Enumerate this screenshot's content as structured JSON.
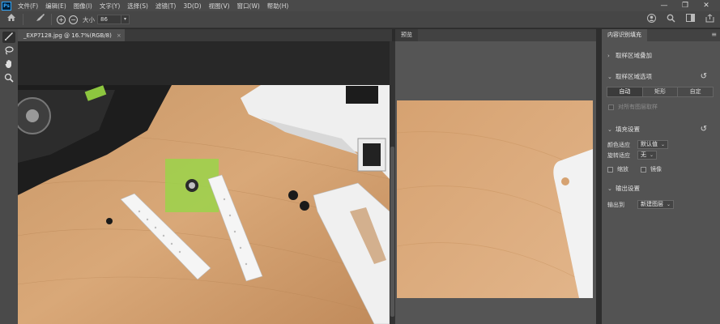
{
  "app": {
    "logo": "Ps"
  },
  "menu": [
    "文件(F)",
    "编辑(E)",
    "图像(I)",
    "文字(Y)",
    "选择(S)",
    "滤镜(T)",
    "3D(D)",
    "视图(V)",
    "窗口(W)",
    "帮助(H)"
  ],
  "window_controls": {
    "minimize": "—",
    "maximize": "❐",
    "close": "✕"
  },
  "options": {
    "size_label": "大小",
    "size_value": "86",
    "plus": "+",
    "minus": "−"
  },
  "document": {
    "tab_title": "_EXP7128.jpg @ 16.7%(RGB/8)",
    "close": "×"
  },
  "preview": {
    "tab_label": "预览"
  },
  "panel": {
    "tab_label": "内容识别填充",
    "sampling_overlay": "取样区域叠加",
    "sampling_options": "取样区域选项",
    "mode_buttons": [
      "自动",
      "矩形",
      "自定"
    ],
    "sample_all_layers": "对所有图层取样",
    "fill_settings": "填充设置",
    "color_adapt_label": "颜色适应",
    "color_adapt_value": "默认值",
    "rotation_adapt_label": "旋转适应",
    "rotation_adapt_value": "无",
    "scale_label": "缩放",
    "mirror_label": "镜像",
    "output_settings": "输出设置",
    "output_to_label": "输出到",
    "output_to_value": "新建图层"
  },
  "colors": {
    "menubar": "#4a4a4a",
    "panel": "#535353",
    "canvas_bg": "#282828",
    "sample_overlay": "#9bd44a",
    "wood": "#d9a878"
  }
}
